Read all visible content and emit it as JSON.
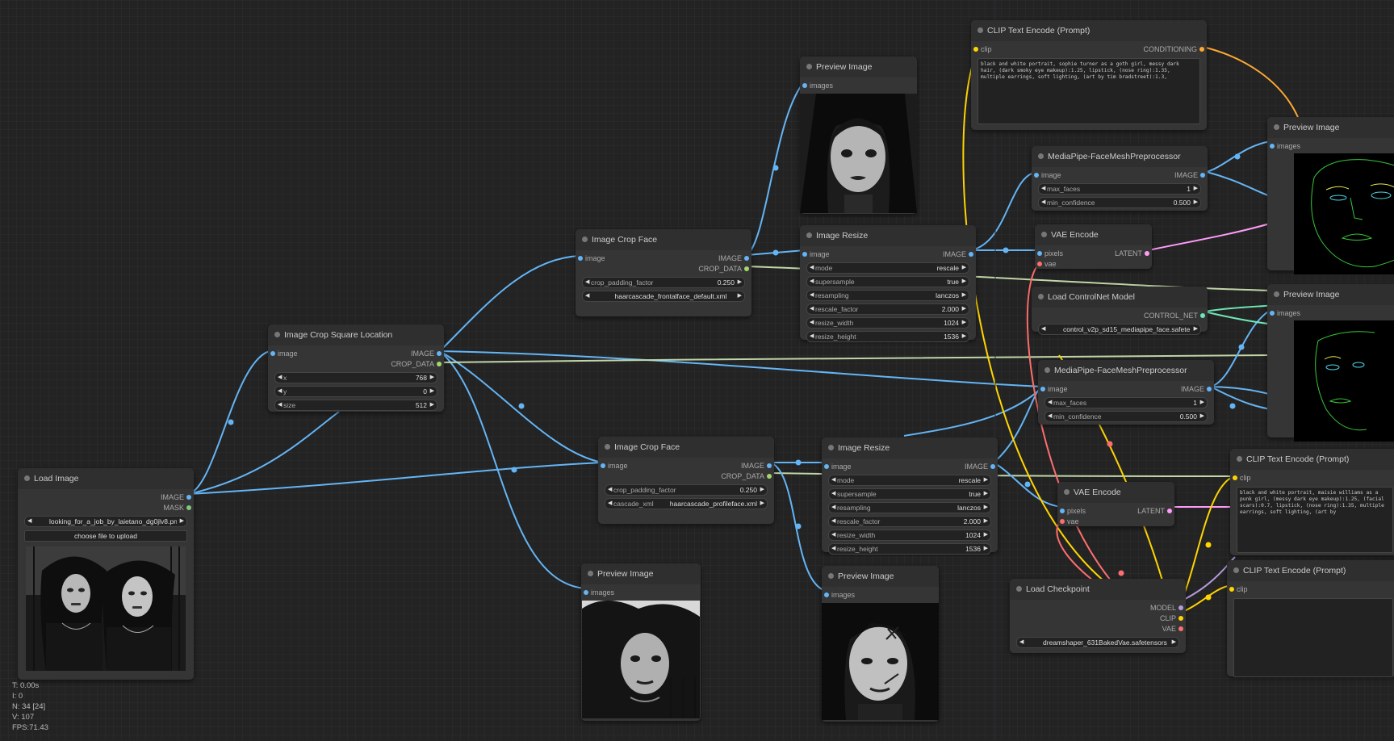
{
  "colors": {
    "image": "#64b5f6",
    "mask": "#81c784",
    "crop_data": "#a5d66b",
    "latent": "#ff9cf9",
    "vae": "#ff6e6e",
    "clip": "#ffd500",
    "conditioning": "#ffa931",
    "model": "#b39ddb",
    "control_net": "#6ee7b7",
    "background": "#232323",
    "node": "#353535"
  },
  "nodes": {
    "load_image": {
      "title": "Load Image",
      "out_image": "IMAGE",
      "out_mask": "MASK",
      "image_file": "looking_for_a_job_by_laietano_dg0jlv8.png",
      "upload_btn": "choose file to upload"
    },
    "crop_square": {
      "title": "Image Crop Square Location",
      "in_image": "image",
      "out_image": "IMAGE",
      "out_crop": "CROP_DATA",
      "x_label": "x",
      "x_value": "768",
      "y_label": "y",
      "y_value": "0",
      "size_label": "size",
      "size_value": "512"
    },
    "crop_face_1": {
      "title": "Image Crop Face",
      "in_image": "image",
      "out_image": "IMAGE",
      "out_crop": "CROP_DATA",
      "pad_label": "crop_padding_factor",
      "pad_value": "0.250",
      "cascade_label": "cascade_xml",
      "cascade_value": "haarcascade_frontalface_default.xml"
    },
    "crop_face_2": {
      "title": "Image Crop Face",
      "in_image": "image",
      "out_image": "IMAGE",
      "out_crop": "CROP_DATA",
      "pad_label": "crop_padding_factor",
      "pad_value": "0.250",
      "cascade_label": "cascade_xml",
      "cascade_value": "haarcascade_profileface.xml"
    },
    "preview_top": {
      "title": "Preview Image",
      "in_images": "images"
    },
    "preview_bottom_left": {
      "title": "Preview Image",
      "in_images": "images"
    },
    "preview_bottom_mid": {
      "title": "Preview Image",
      "in_images": "images"
    },
    "resize_1": {
      "title": "Image Resize",
      "in_image": "image",
      "out_image": "IMAGE",
      "mode_label": "mode",
      "mode_value": "rescale",
      "super_label": "supersample",
      "super_value": "true",
      "resamp_label": "resampling",
      "resamp_value": "lanczos",
      "factor_label": "rescale_factor",
      "factor_value": "2.000",
      "width_label": "resize_width",
      "width_value": "1024",
      "height_label": "resize_height",
      "height_value": "1536"
    },
    "resize_2": {
      "title": "Image Resize",
      "in_image": "image",
      "out_image": "IMAGE",
      "mode_label": "mode",
      "mode_value": "rescale",
      "super_label": "supersample",
      "super_value": "true",
      "resamp_label": "resampling",
      "resamp_value": "lanczos",
      "factor_label": "rescale_factor",
      "factor_value": "2.000",
      "width_label": "resize_width",
      "width_value": "1024",
      "height_label": "resize_height",
      "height_value": "1536"
    },
    "clip_text_1": {
      "title": "CLIP Text Encode (Prompt)",
      "in_clip": "clip",
      "out_cond": "CONDITIONING",
      "text": "black and white portrait, sophie turner as a goth girl, messy dark hair, (dark smoky eye makeup):1.25, lipstick, (nose ring):1.35, multiple earrings, soft lighting, (art by tim bradstreet):1.3,"
    },
    "clip_text_2": {
      "title": "CLIP Text Encode (Prompt)",
      "in_clip": "clip",
      "text": "black and white portrait, maisie williams as a punk girl, (messy dark eye makeup):1.25, (facial scars):0.7, lipstick, (nose ring):1.35, multiple earrings, soft lighting, (art by"
    },
    "clip_text_3": {
      "title": "CLIP Text Encode (Prompt)",
      "in_clip": "clip"
    },
    "facemesh_1": {
      "title": "MediaPipe-FaceMeshPreprocessor",
      "in_image": "image",
      "out_image": "IMAGE",
      "faces_label": "max_faces",
      "faces_value": "1",
      "conf_label": "min_confidence",
      "conf_value": "0.500"
    },
    "facemesh_2": {
      "title": "MediaPipe-FaceMeshPreprocessor",
      "in_image": "image",
      "out_image": "IMAGE",
      "faces_label": "max_faces",
      "faces_value": "1",
      "conf_label": "min_confidence",
      "conf_value": "0.500"
    },
    "vae_encode_1": {
      "title": "VAE Encode",
      "in_pixels": "pixels",
      "in_vae": "vae",
      "out_latent": "LATENT"
    },
    "vae_encode_2": {
      "title": "VAE Encode",
      "in_pixels": "pixels",
      "in_vae": "vae",
      "out_latent": "LATENT"
    },
    "controlnet": {
      "title": "Load ControlNet Model",
      "out": "CONTROL_NET",
      "name_label": "control_net_name",
      "name_value": "control_v2p_sd15_mediapipe_face.safetensors"
    },
    "checkpoint": {
      "title": "Load Checkpoint",
      "out_model": "MODEL",
      "out_clip": "CLIP",
      "out_vae": "VAE",
      "ckpt_label": "ckpt_name",
      "ckpt_value": "dreamshaper_631BakedVae.safetensors"
    },
    "preview_right_1": {
      "title": "Preview Image",
      "in_images": "images"
    },
    "preview_right_2": {
      "title": "Preview Image",
      "in_images": "images"
    }
  },
  "stats": {
    "t": "T: 0.00s",
    "i": "I: 0",
    "n": "N: 34 [24]",
    "v": "V: 107",
    "fps": "FPS:71.43"
  }
}
